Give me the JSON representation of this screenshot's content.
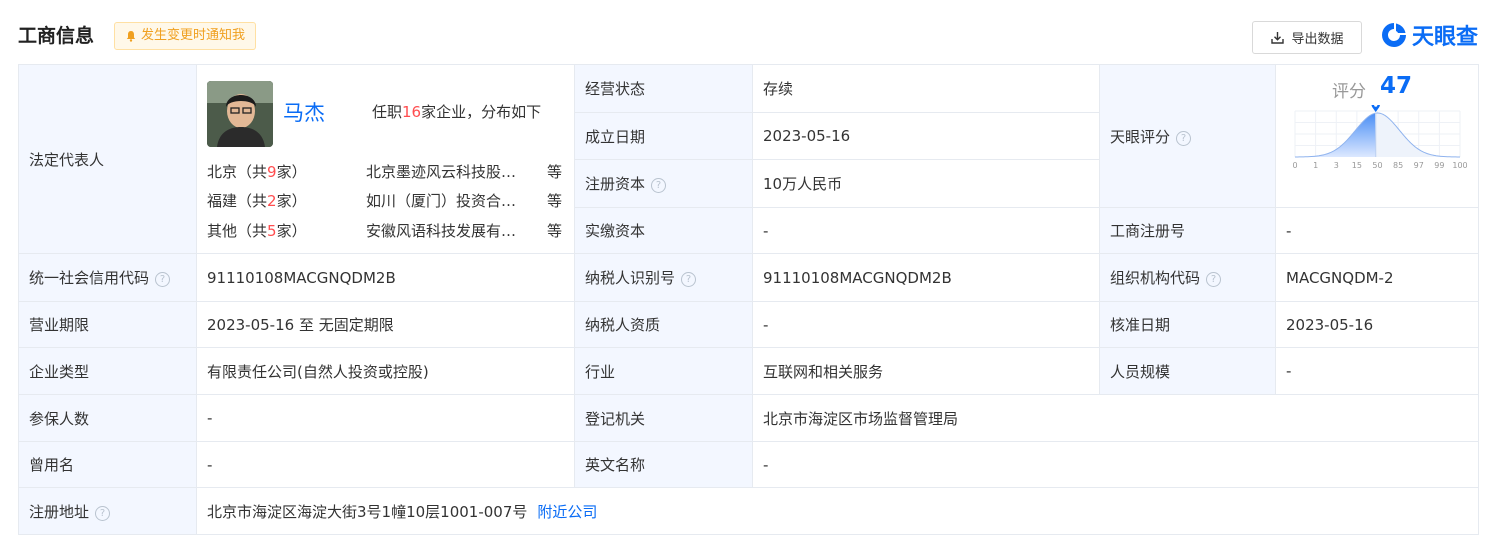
{
  "header": {
    "title": "工商信息",
    "notify_label": "发生变更时通知我",
    "export_label": "导出数据",
    "brand": "天眼查"
  },
  "legal": {
    "label": "法定代表人",
    "name": "马杰",
    "duty_prefix": "任职",
    "duty_count": "16",
    "duty_suffix": "家企业，分布如下",
    "regions": [
      {
        "pre": "北京（共",
        "count": "9",
        "post": "家）",
        "company": "北京墨迹风云科技股…",
        "more": "等"
      },
      {
        "pre": "福建（共",
        "count": "2",
        "post": "家）",
        "company": "如川（厦门）投资合…",
        "more": "等"
      },
      {
        "pre": "其他（共",
        "count": "5",
        "post": "家）",
        "company": "安徽风语科技发展有…",
        "more": "等"
      }
    ]
  },
  "fields": {
    "status": {
      "label": "经营状态",
      "value": "存续"
    },
    "founded": {
      "label": "成立日期",
      "value": "2023-05-16"
    },
    "reg_capital": {
      "label": "注册资本",
      "value": "10万人民币"
    },
    "paid_capital": {
      "label": "实缴资本",
      "value": "-"
    },
    "score": {
      "label": "天眼评分",
      "title": "评分",
      "value": "47",
      "axis": [
        "0",
        "1",
        "3",
        "15",
        "50",
        "85",
        "97",
        "99",
        "100"
      ]
    },
    "reg_no": {
      "label": "工商注册号",
      "value": "-"
    },
    "credit_code": {
      "label": "统一社会信用代码",
      "value": "91110108MACGNQDM2B"
    },
    "taxpayer_id": {
      "label": "纳税人识别号",
      "value": "91110108MACGNQDM2B"
    },
    "org_code": {
      "label": "组织机构代码",
      "value": "MACGNQDM-2"
    },
    "period": {
      "label": "营业期限",
      "value": "2023-05-16 至 无固定期限"
    },
    "taxpayer_qual": {
      "label": "纳税人资质",
      "value": "-"
    },
    "approved": {
      "label": "核准日期",
      "value": "2023-05-16"
    },
    "type": {
      "label": "企业类型",
      "value": "有限责任公司(自然人投资或控股)"
    },
    "industry": {
      "label": "行业",
      "value": "互联网和相关服务"
    },
    "staff": {
      "label": "人员规模",
      "value": "-"
    },
    "insured": {
      "label": "参保人数",
      "value": "-"
    },
    "authority": {
      "label": "登记机关",
      "value": "北京市海淀区市场监督管理局"
    },
    "former": {
      "label": "曾用名",
      "value": "-"
    },
    "english": {
      "label": "英文名称",
      "value": "-"
    },
    "address": {
      "label": "注册地址",
      "value": "北京市海淀区海淀大街3号1幢10层1001-007号",
      "link": "附近公司"
    }
  },
  "colors": {
    "accent": "#0a6cf5",
    "label_bg": "#f3f7ff",
    "highlight": "#ff4d4f",
    "notify": "#f0a020"
  }
}
